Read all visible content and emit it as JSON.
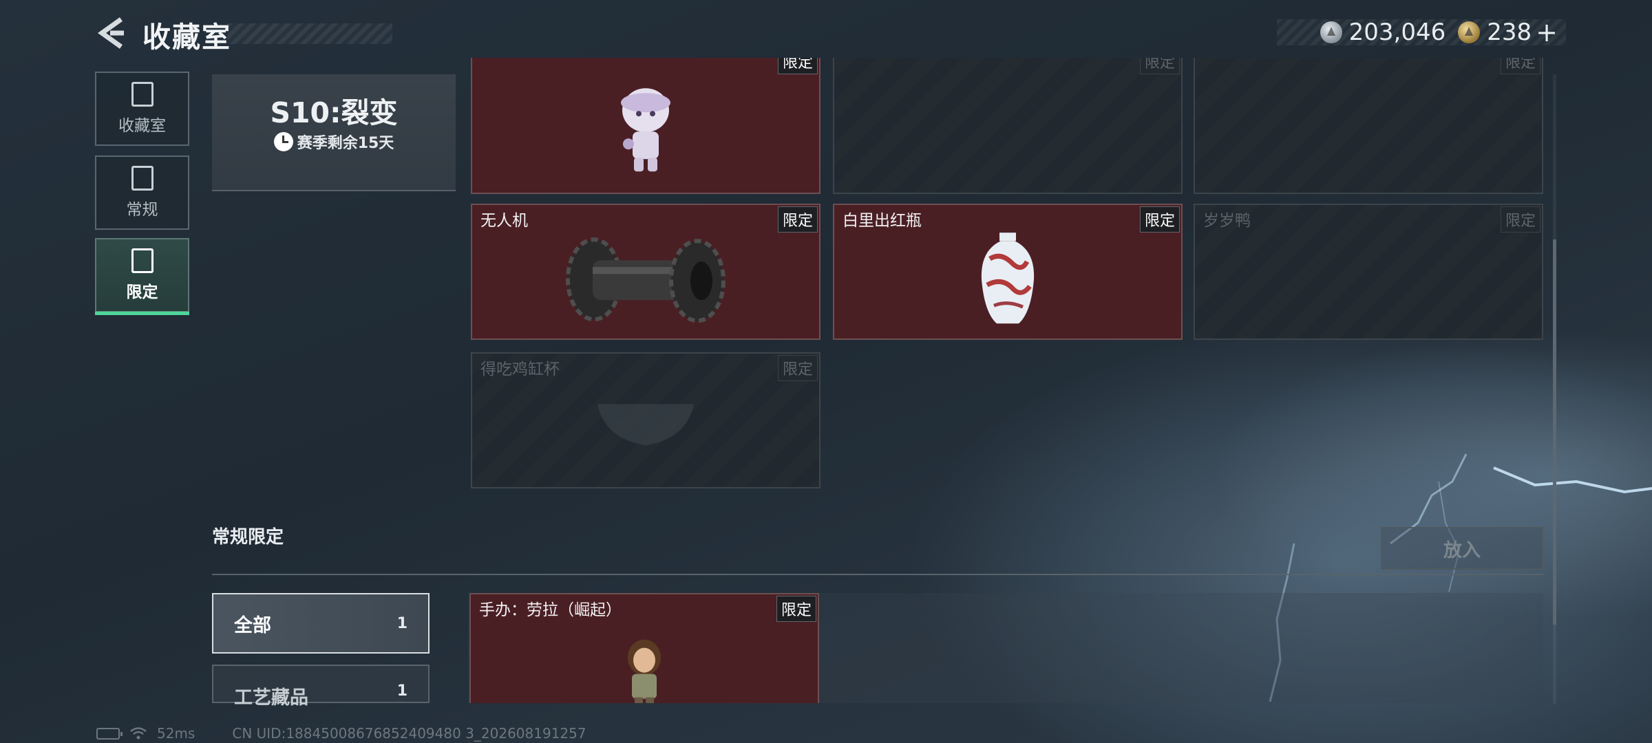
{
  "header": {
    "title": "收藏室",
    "currency_silver": "203,046",
    "currency_gold": "238",
    "plus": "+"
  },
  "nav": [
    {
      "label": "收藏室",
      "icon": "vault-icon"
    },
    {
      "label": "常规",
      "icon": "regular-icon"
    },
    {
      "label": "限定",
      "icon": "limited-icon",
      "active": true
    }
  ],
  "season": {
    "title": "S10:裂变",
    "remaining": "赛季剩余15天"
  },
  "cards": [
    {
      "name": "",
      "tag": "限定",
      "owned": true
    },
    {
      "name": "",
      "tag": "限定",
      "owned": false
    },
    {
      "name": "",
      "tag": "限定",
      "owned": false
    },
    {
      "name": "无人机",
      "tag": "限定",
      "owned": true
    },
    {
      "name": "白里出红瓶",
      "tag": "限定",
      "owned": true
    },
    {
      "name": "岁岁鸭",
      "tag": "限定",
      "owned": false
    },
    {
      "name": "得吃鸡缸杯",
      "tag": "限定",
      "owned": false
    }
  ],
  "section": {
    "title": "常规限定",
    "put_button": "放入"
  },
  "filters": [
    {
      "label": "全部",
      "count": "1",
      "active": true
    },
    {
      "label": "工艺藏品",
      "count": "1"
    }
  ],
  "bottom_card": {
    "name": "手办：劳拉（崛起）",
    "tag": "限定"
  },
  "status": {
    "ping": "52ms",
    "uid": "CN UID:18845008676852409480 3_202608191257"
  },
  "colors": {
    "accent_green": "#4ed69c",
    "owned_card_bg": "#4a1f24",
    "locked_card_bg": "#242b31"
  }
}
